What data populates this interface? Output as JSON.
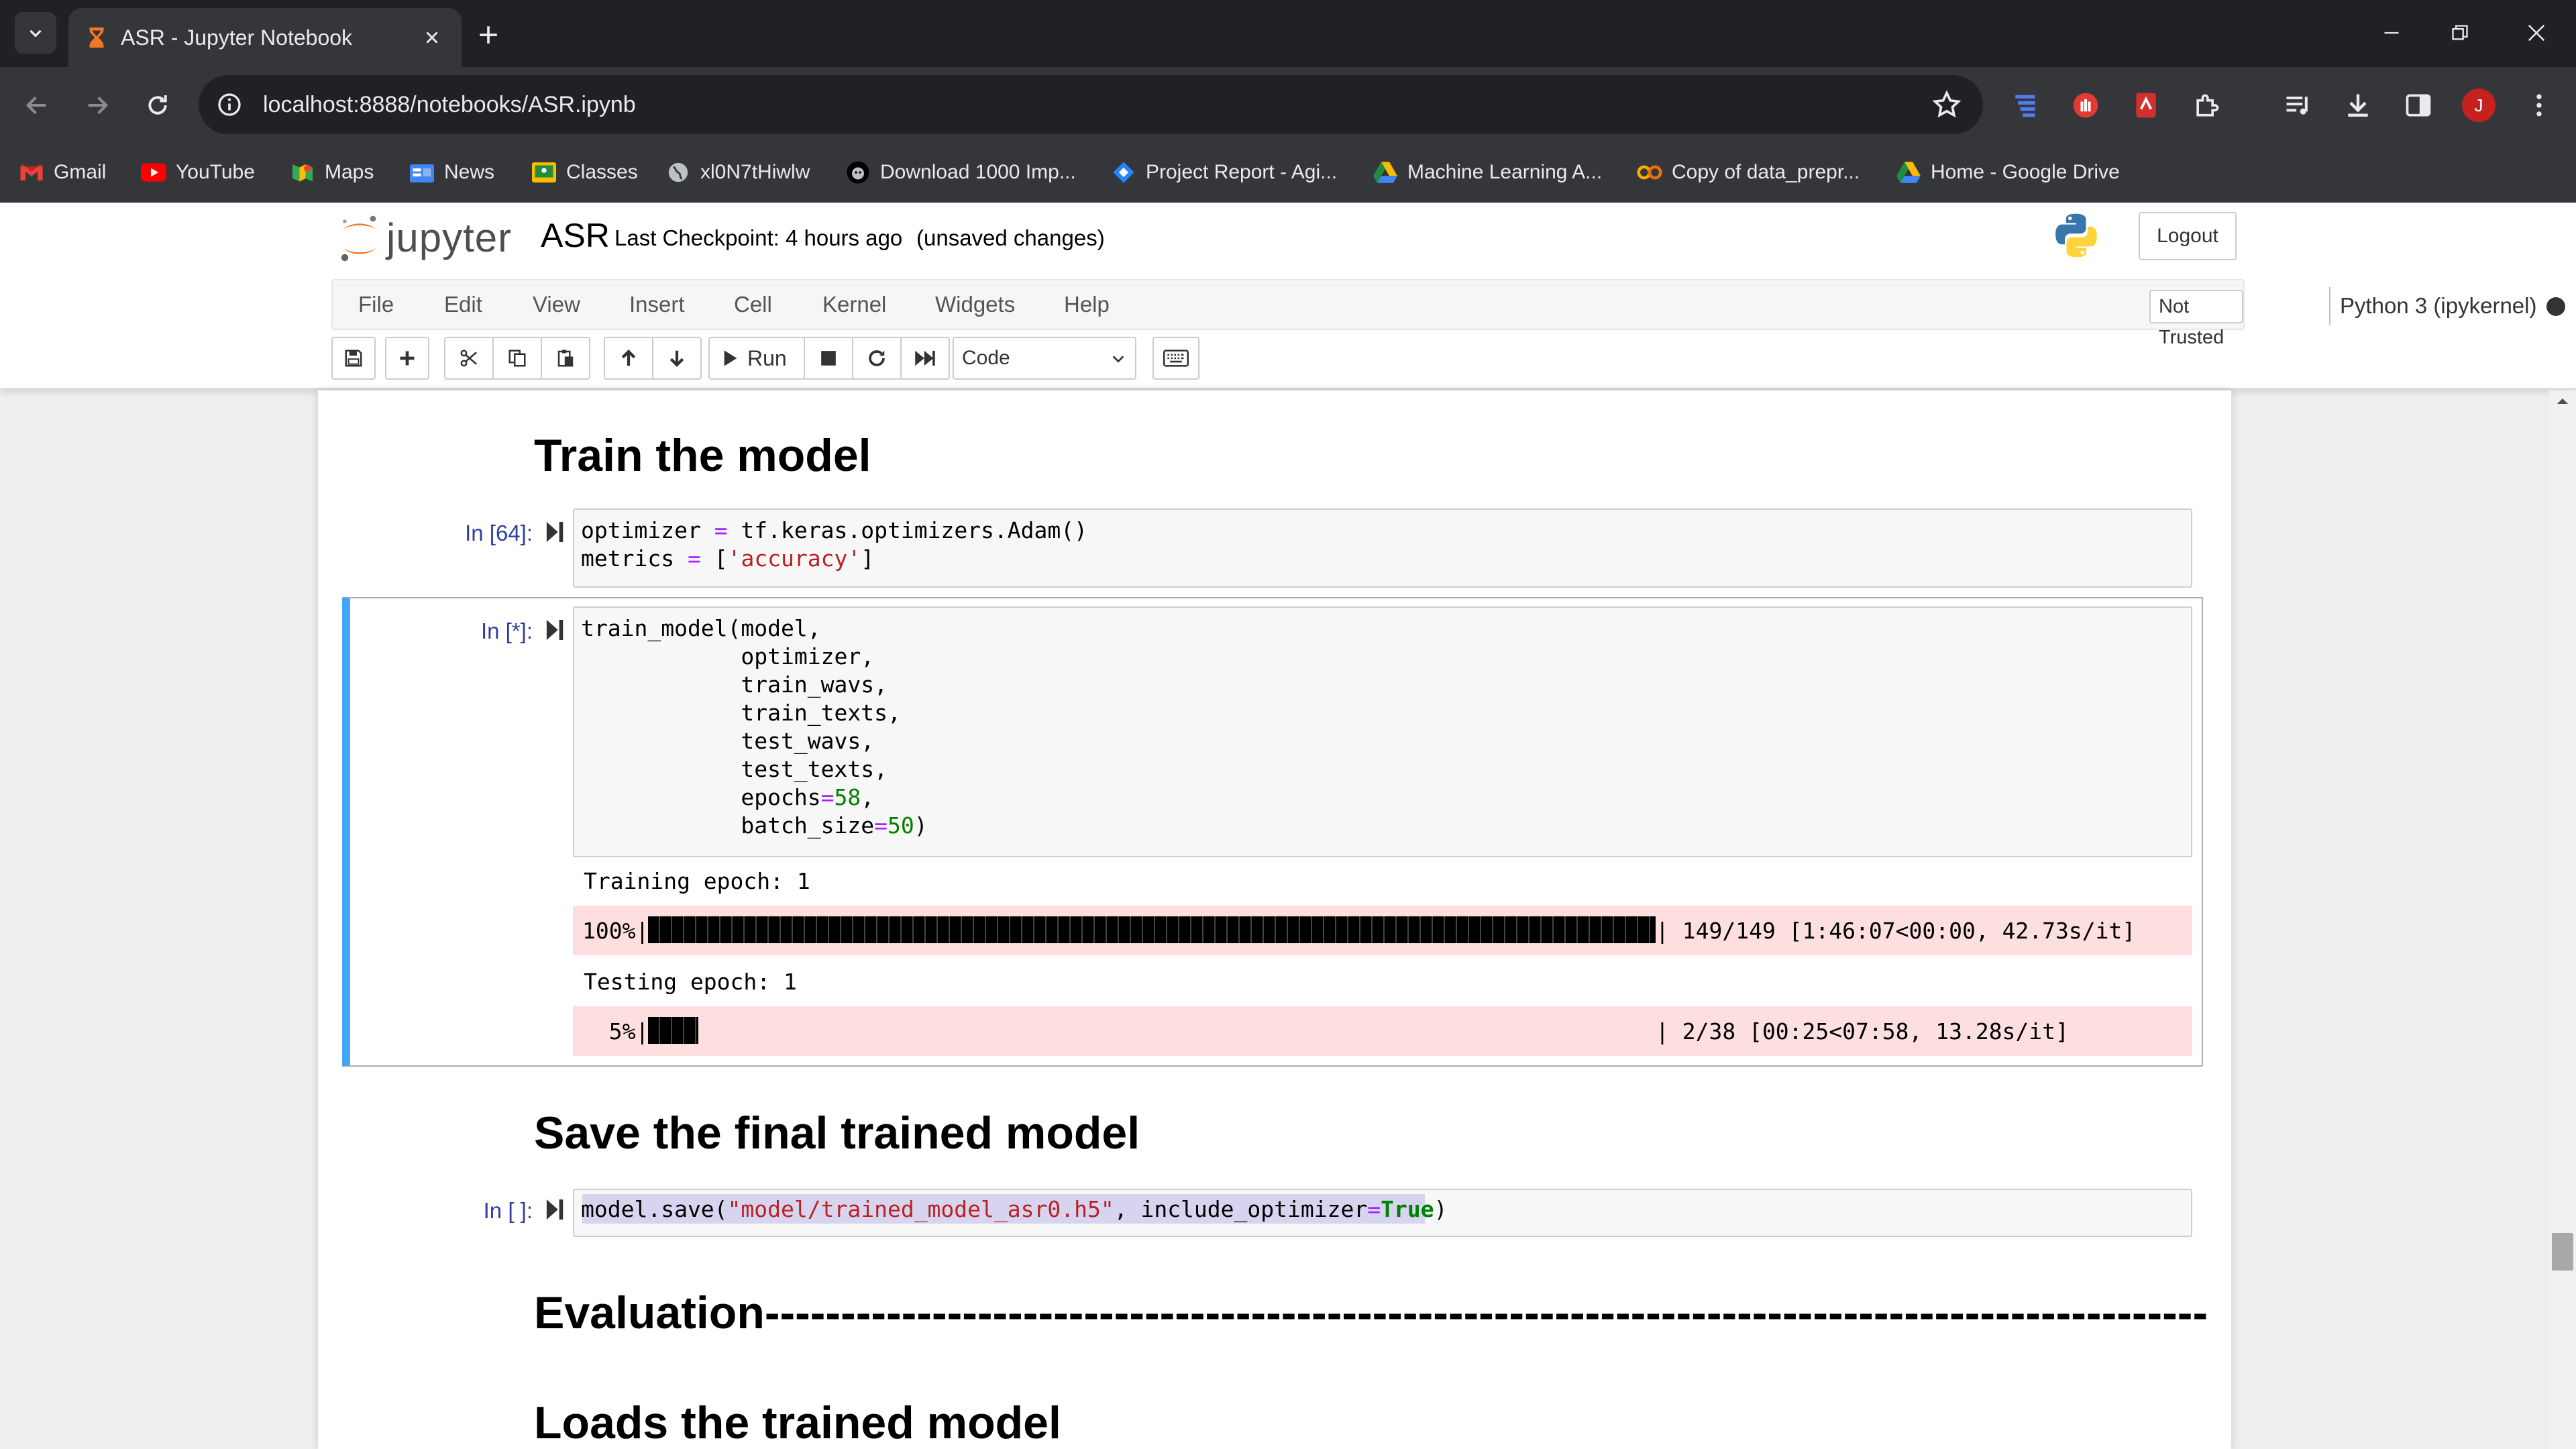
{
  "browser": {
    "tab_title": "ASR - Jupyter Notebook",
    "url": "localhost:8888/notebooks/ASR.ipynb",
    "bookmarks": [
      "Gmail",
      "YouTube",
      "Maps",
      "News",
      "Classes",
      "xl0N7tHiwlw",
      "Download 1000 Imp...",
      "Project Report - Agi...",
      "Machine Learning A...",
      "Copy of data_prepr...",
      "Home - Google Drive"
    ],
    "profile_initial": "J"
  },
  "jupyter": {
    "logo_text": "jupyter",
    "notebook_name": "ASR",
    "checkpoint": "Last Checkpoint: 4 hours ago",
    "status": "(unsaved changes)",
    "logout": "Logout",
    "menus": [
      "File",
      "Edit",
      "View",
      "Insert",
      "Cell",
      "Kernel",
      "Widgets",
      "Help"
    ],
    "trust": "Not Trusted",
    "kernel": "Python 3 (ipykernel)",
    "run_label": "Run",
    "cell_type": "Code"
  },
  "cells": {
    "h_train": "Train the model",
    "c1_prompt": "In [64]:",
    "c1_line1_a": "optimizer ",
    "c1_line1_op": "=",
    "c1_line1_b": " tf.keras.optimizers.Adam()",
    "c1_line2_a": "metrics ",
    "c1_line2_op": "=",
    "c1_line2_b": " [",
    "c1_line2_str": "'accuracy'",
    "c1_line2_c": "]",
    "c2_prompt": "In [*]:",
    "c2_l1": "train_model(model,",
    "c2_l2": "            optimizer,",
    "c2_l3": "            train_wavs,",
    "c2_l4": "            train_texts,",
    "c2_l5": "            test_wavs,",
    "c2_l6": "            test_texts,",
    "c2_l7_a": "            epochs",
    "c2_l7_op": "=",
    "c2_l7_num": "58",
    "c2_l7_b": ",",
    "c2_l8_a": "            batch_size",
    "c2_l8_op": "=",
    "c2_l8_num": "50",
    "c2_l8_b": ")",
    "out_train_epoch": "Training epoch: 1",
    "pbar1_pct": "100%|",
    "pbar1_stats": "| 149/149 [1:46:07<00:00, 42.73s/it]",
    "pbar1_fraction": 1.0,
    "out_test_epoch": "Testing epoch: 1",
    "pbar2_pct": "  5%|",
    "pbar2_stats": "| 2/38 [00:25<07:58, 13.28s/it]",
    "pbar2_fraction": 0.05,
    "h_save": "Save the final trained model",
    "c3_prompt": "In [ ]:",
    "c3_a": "model.save(",
    "c3_str": "\"model/trained_model_asr0.h5\"",
    "c3_b": ", include_optimizer",
    "c3_op": "=",
    "c3_true": "True",
    "c3_c": ")",
    "h_eval": "Evaluation-----------------------------------------------------------------------------------------------",
    "h_load": "Loads the trained model"
  },
  "colors": {
    "selected_border": "#42a5f5",
    "stderr_bg": "#fddfdf",
    "prompt_in": "#303f9f"
  }
}
